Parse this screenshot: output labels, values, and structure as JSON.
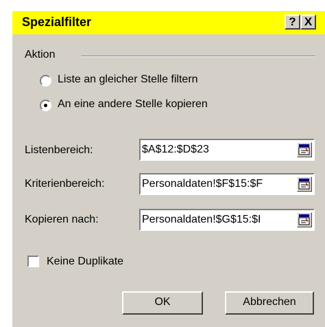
{
  "window": {
    "title": "Spezialfilter",
    "help_label": "?",
    "close_label": "X"
  },
  "action_group": {
    "label": "Aktion",
    "options": [
      {
        "label": "Liste an gleicher Stelle filtern",
        "selected": false
      },
      {
        "label": "An eine andere Stelle kopieren",
        "selected": true
      }
    ]
  },
  "fields": {
    "list_range": {
      "label": "Listenbereich:",
      "value": "$A$12:$D$23"
    },
    "criteria_range": {
      "label": "Kriterienbereich:",
      "value": "Personaldaten!$F$15:$F"
    },
    "copy_to": {
      "label": "Kopieren nach:",
      "value": "Personaldaten!$G$15:$I"
    }
  },
  "unique_records": {
    "label": "Keine Duplikate",
    "checked": false
  },
  "buttons": {
    "ok": "OK",
    "cancel": "Abbrechen"
  },
  "icons": {
    "collapse": "collapse-dialog-icon"
  },
  "colors": {
    "titlebar": "#ffff00",
    "dialog": "#d4d0c8"
  }
}
